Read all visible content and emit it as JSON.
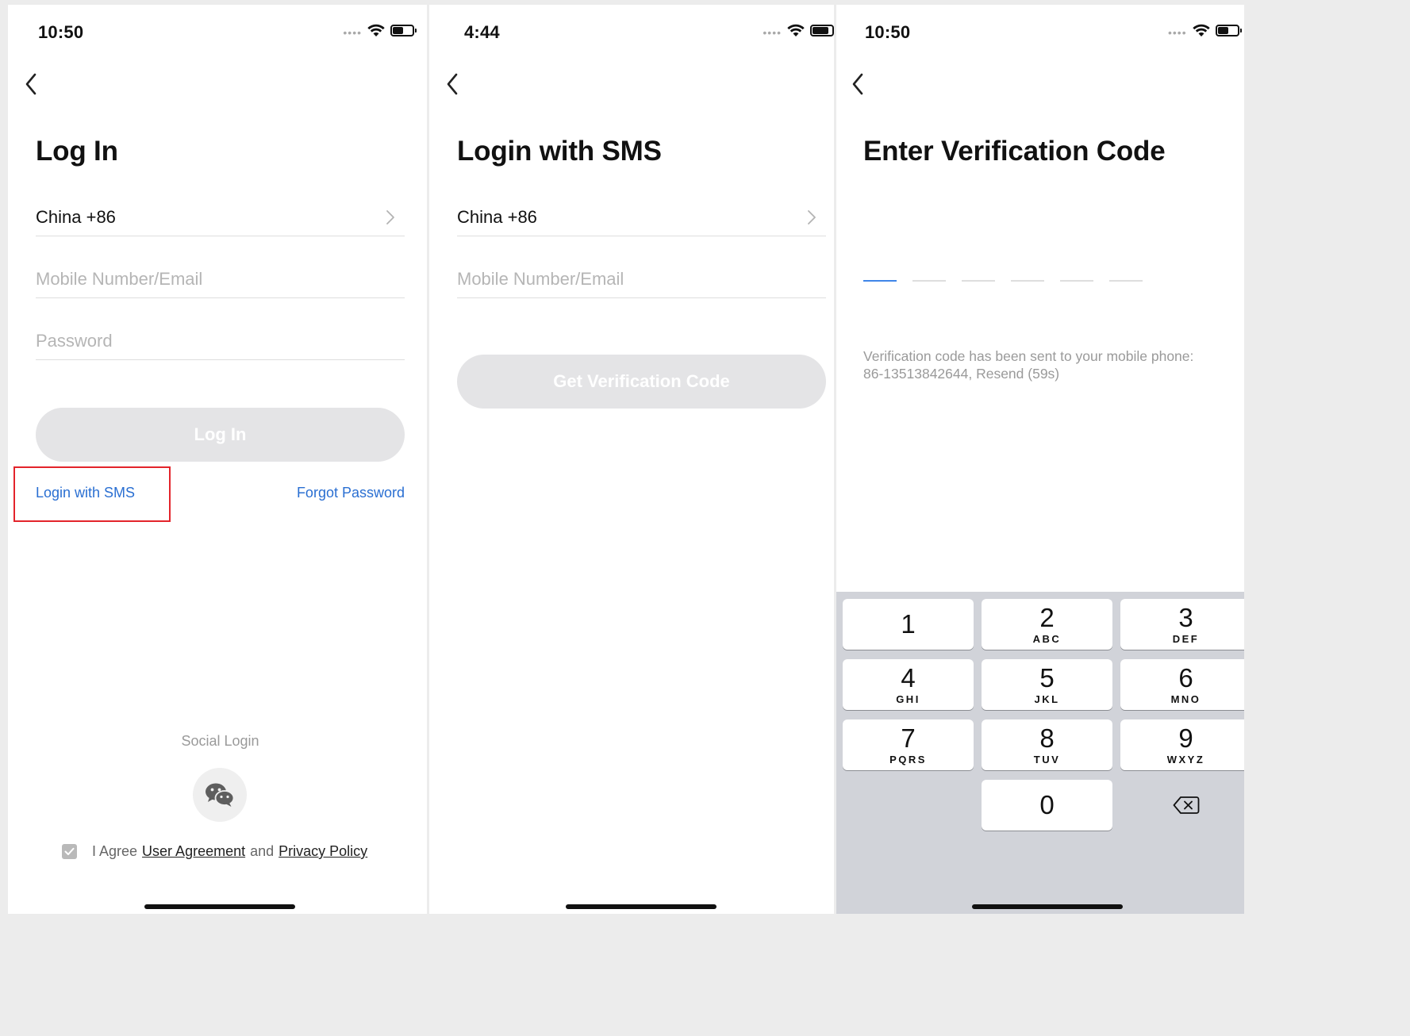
{
  "screens": {
    "login": {
      "time": "10:50",
      "battery_level": 0.55,
      "title": "Log In",
      "country_code": "China +86",
      "mobile_placeholder": "Mobile Number/Email",
      "password_placeholder": "Password",
      "login_button": "Log In",
      "sms_link": "Login with SMS",
      "forgot_link": "Forgot Password",
      "social_label": "Social Login",
      "wechat_icon": "wechat-icon",
      "agree_prefix": "I Agree",
      "user_agreement": "User Agreement",
      "agree_and": "and",
      "privacy_policy": "Privacy Policy"
    },
    "sms": {
      "time": "4:44",
      "battery_level": 0.85,
      "title": "Login with SMS",
      "country_code": "China +86",
      "mobile_placeholder": "Mobile Number/Email",
      "get_code_button": "Get Verification Code"
    },
    "verify": {
      "time": "10:50",
      "battery_level": 0.55,
      "title": "Enter Verification Code",
      "code_length": 6,
      "message": "Verification code has been sent to your mobile phone: 86-13513842644, Resend (59s)"
    }
  },
  "keypad": {
    "keys": [
      {
        "num": "1",
        "letters": ""
      },
      {
        "num": "2",
        "letters": "ABC"
      },
      {
        "num": "3",
        "letters": "DEF"
      },
      {
        "num": "4",
        "letters": "GHI"
      },
      {
        "num": "5",
        "letters": "JKL"
      },
      {
        "num": "6",
        "letters": "MNO"
      },
      {
        "num": "7",
        "letters": "PQRS"
      },
      {
        "num": "8",
        "letters": "TUV"
      },
      {
        "num": "9",
        "letters": "WXYZ"
      },
      {
        "num": "0",
        "letters": ""
      }
    ],
    "delete_icon": "backspace-icon"
  },
  "colors": {
    "accent": "#2a6fd2",
    "highlight": "#e3242b",
    "disabled_button": "#e4e4e6",
    "active_slot": "#3f86e8",
    "keypad_bg": "#d1d3d9"
  }
}
